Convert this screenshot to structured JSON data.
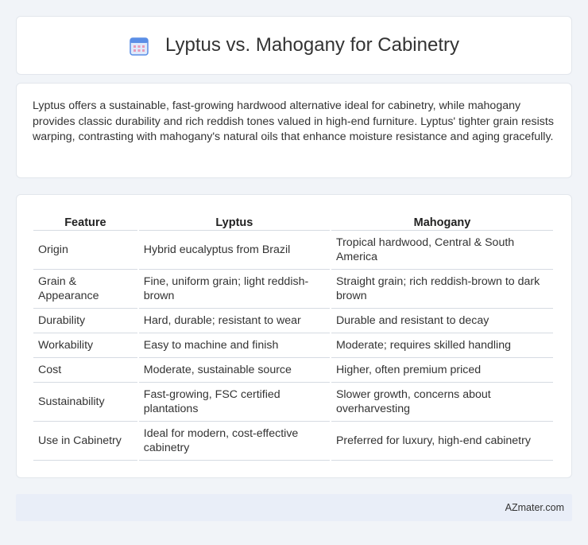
{
  "title": "Lyptus vs. Mahogany for Cabinetry",
  "intro": "Lyptus offers a sustainable, fast-growing hardwood alternative ideal for cabinetry, while mahogany provides classic durability and rich reddish tones valued in high-end furniture. Lyptus' tighter grain resists warping, contrasting with mahogany's natural oils that enhance moisture resistance and aging gracefully.",
  "table": {
    "headers": [
      "Feature",
      "Lyptus",
      "Mahogany"
    ],
    "rows": [
      [
        "Origin",
        "Hybrid eucalyptus from Brazil",
        "Tropical hardwood, Central & South America"
      ],
      [
        "Grain & Appearance",
        "Fine, uniform grain; light reddish-brown",
        "Straight grain; rich reddish-brown to dark brown"
      ],
      [
        "Durability",
        "Hard, durable; resistant to wear",
        "Durable and resistant to decay"
      ],
      [
        "Workability",
        "Easy to machine and finish",
        "Moderate; requires skilled handling"
      ],
      [
        "Cost",
        "Moderate, sustainable source",
        "Higher, often premium priced"
      ],
      [
        "Sustainability",
        "Fast-growing, FSC certified plantations",
        "Slower growth, concerns about overharvesting"
      ],
      [
        "Use in Cabinetry",
        "Ideal for modern, cost-effective cabinetry",
        "Preferred for luxury, high-end cabinetry"
      ]
    ]
  },
  "footer": "AZmater.com",
  "icon": "calendar-icon",
  "colors": {
    "background": "#f1f4f8",
    "footer_bg": "#e9eef8",
    "icon_blue": "#5a8ee6",
    "icon_pink": "#e89ab8"
  }
}
